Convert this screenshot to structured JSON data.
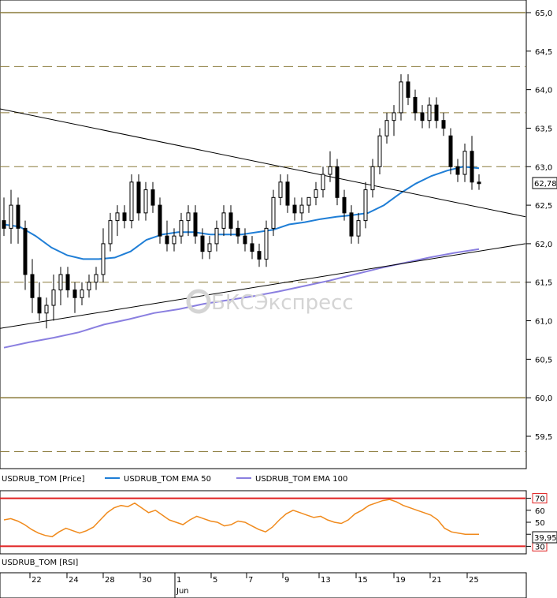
{
  "chart_data": [
    {
      "type": "candlestick",
      "title": "",
      "ylim": [
        59.2,
        65.1
      ],
      "y_ticks": [
        "59,5",
        "60,0",
        "60,5",
        "61,0",
        "61,5",
        "62,0",
        "62,5",
        "63,0",
        "63,5",
        "64,0",
        "64,5",
        "65,0"
      ],
      "current_price_label": "62,782",
      "legend": [
        {
          "label": "USDRUB_TOM [Price]",
          "color": ""
        },
        {
          "label": "USDRUB_TOM EMA 50",
          "color": "#1f7ed6"
        },
        {
          "label": "USDRUB_TOM EMA 100",
          "color": "#8a7fe0"
        }
      ],
      "horizontal_levels": [
        59.3,
        60.0,
        61.5,
        63.0,
        63.7,
        64.3,
        65.0
      ],
      "trendlines": [
        {
          "from": [
            0,
            63.75
          ],
          "to": [
            120,
            62.35
          ]
        },
        {
          "from": [
            0,
            60.9
          ],
          "to": [
            120,
            62.0
          ]
        }
      ],
      "candles": [
        [
          62.3,
          62.6,
          62.1,
          62.2
        ],
        [
          62.2,
          62.7,
          62.0,
          62.5
        ],
        [
          62.5,
          62.6,
          62.0,
          62.2
        ],
        [
          62.2,
          62.3,
          61.4,
          61.6
        ],
        [
          61.6,
          61.8,
          61.1,
          61.3
        ],
        [
          61.3,
          61.5,
          61.0,
          61.1
        ],
        [
          61.1,
          61.3,
          60.9,
          61.2
        ],
        [
          61.2,
          61.6,
          61.0,
          61.4
        ],
        [
          61.4,
          61.7,
          61.2,
          61.6
        ],
        [
          61.6,
          61.7,
          61.3,
          61.4
        ],
        [
          61.4,
          61.5,
          61.1,
          61.3
        ],
        [
          61.3,
          61.5,
          61.2,
          61.4
        ],
        [
          61.4,
          61.6,
          61.3,
          61.5
        ],
        [
          61.5,
          61.7,
          61.4,
          61.6
        ],
        [
          61.6,
          62.2,
          61.5,
          62.0
        ],
        [
          62.0,
          62.4,
          61.9,
          62.3
        ],
        [
          62.3,
          62.5,
          62.1,
          62.4
        ],
        [
          62.4,
          62.5,
          62.2,
          62.3
        ],
        [
          62.3,
          62.9,
          62.2,
          62.8
        ],
        [
          62.8,
          62.9,
          62.3,
          62.4
        ],
        [
          62.4,
          62.8,
          62.3,
          62.7
        ],
        [
          62.7,
          62.8,
          62.4,
          62.5
        ],
        [
          62.5,
          62.6,
          62.0,
          62.1
        ],
        [
          62.1,
          62.3,
          61.9,
          62.0
        ],
        [
          62.0,
          62.2,
          61.9,
          62.1
        ],
        [
          62.1,
          62.4,
          62.0,
          62.3
        ],
        [
          62.3,
          62.5,
          62.1,
          62.4
        ],
        [
          62.4,
          62.5,
          62.0,
          62.1
        ],
        [
          62.1,
          62.2,
          61.8,
          61.9
        ],
        [
          61.9,
          62.1,
          61.8,
          62.0
        ],
        [
          62.0,
          62.3,
          61.9,
          62.2
        ],
        [
          62.2,
          62.5,
          62.1,
          62.4
        ],
        [
          62.4,
          62.5,
          62.1,
          62.2
        ],
        [
          62.2,
          62.3,
          62.0,
          62.1
        ],
        [
          62.1,
          62.2,
          61.9,
          62.0
        ],
        [
          62.0,
          62.1,
          61.8,
          61.9
        ],
        [
          61.9,
          62.0,
          61.7,
          61.8
        ],
        [
          61.8,
          62.3,
          61.7,
          62.2
        ],
        [
          62.2,
          62.7,
          62.1,
          62.6
        ],
        [
          62.6,
          62.9,
          62.5,
          62.8
        ],
        [
          62.8,
          62.9,
          62.4,
          62.5
        ],
        [
          62.5,
          62.6,
          62.3,
          62.4
        ],
        [
          62.4,
          62.6,
          62.3,
          62.5
        ],
        [
          62.5,
          62.6,
          62.4,
          62.6
        ],
        [
          62.6,
          62.8,
          62.5,
          62.7
        ],
        [
          62.7,
          63.0,
          62.6,
          62.9
        ],
        [
          62.9,
          63.2,
          62.8,
          63.0
        ],
        [
          63.0,
          63.1,
          62.5,
          62.6
        ],
        [
          62.6,
          62.7,
          62.3,
          62.4
        ],
        [
          62.4,
          62.5,
          62.0,
          62.1
        ],
        [
          62.1,
          62.4,
          62.0,
          62.3
        ],
        [
          62.3,
          62.8,
          62.2,
          62.7
        ],
        [
          62.7,
          63.1,
          62.6,
          63.0
        ],
        [
          63.0,
          63.5,
          62.9,
          63.4
        ],
        [
          63.4,
          63.7,
          63.3,
          63.6
        ],
        [
          63.6,
          63.8,
          63.4,
          63.7
        ],
        [
          63.7,
          64.2,
          63.6,
          64.1
        ],
        [
          64.1,
          64.2,
          63.8,
          63.9
        ],
        [
          63.9,
          64.0,
          63.6,
          63.7
        ],
        [
          63.7,
          63.8,
          63.5,
          63.6
        ],
        [
          63.6,
          63.9,
          63.5,
          63.8
        ],
        [
          63.8,
          63.9,
          63.5,
          63.6
        ],
        [
          63.6,
          63.7,
          63.4,
          63.5
        ],
        [
          63.4,
          63.5,
          62.9,
          63.0
        ],
        [
          63.0,
          63.1,
          62.8,
          62.9
        ],
        [
          62.9,
          63.3,
          62.8,
          63.2
        ],
        [
          63.2,
          63.4,
          62.7,
          62.8
        ],
        [
          62.8,
          62.9,
          62.7,
          62.78
        ]
      ],
      "ema50": [
        62.25,
        62.22,
        62.1,
        61.95,
        61.85,
        61.8,
        61.8,
        61.82,
        61.9,
        62.05,
        62.12,
        62.15,
        62.15,
        62.12,
        62.12,
        62.12,
        62.15,
        62.18,
        62.25,
        62.28,
        62.32,
        62.35,
        62.37,
        62.4,
        62.5,
        62.65,
        62.78,
        62.88,
        62.95,
        63.0,
        62.98
      ],
      "ema100": [
        60.65,
        60.72,
        60.78,
        60.85,
        60.95,
        61.02,
        61.1,
        61.15,
        61.22,
        61.27,
        61.32,
        61.38,
        61.45,
        61.52,
        61.6,
        61.68,
        61.75,
        61.82,
        61.88,
        61.93
      ],
      "rsi": {
        "label": "USDRUB_TOM [RSI]",
        "levels": [
          "70",
          "30"
        ],
        "ticks": [
          "70",
          "60",
          "50",
          "40",
          "30"
        ],
        "value_label": "39,95",
        "ylim": [
          27,
          73
        ],
        "values": [
          52,
          53,
          51,
          48,
          44,
          41,
          39,
          38,
          42,
          45,
          43,
          41,
          43,
          46,
          52,
          58,
          62,
          64,
          63,
          66,
          62,
          58,
          60,
          56,
          52,
          50,
          48,
          52,
          55,
          53,
          51,
          50,
          47,
          48,
          51,
          50,
          47,
          44,
          42,
          46,
          52,
          57,
          60,
          58,
          56,
          54,
          55,
          52,
          50,
          49,
          52,
          57,
          60,
          64,
          66,
          68,
          69,
          67,
          64,
          62,
          60,
          58,
          56,
          52,
          45,
          42,
          41,
          40,
          40,
          40
        ]
      },
      "x_tick_labels": [
        "22",
        "24",
        "28",
        "30",
        "1",
        "5",
        "7",
        "9",
        "13",
        "15",
        "19",
        "21",
        "25"
      ],
      "x_sub_label": "Jun"
    }
  ],
  "watermark": "БКСЭкспресс"
}
